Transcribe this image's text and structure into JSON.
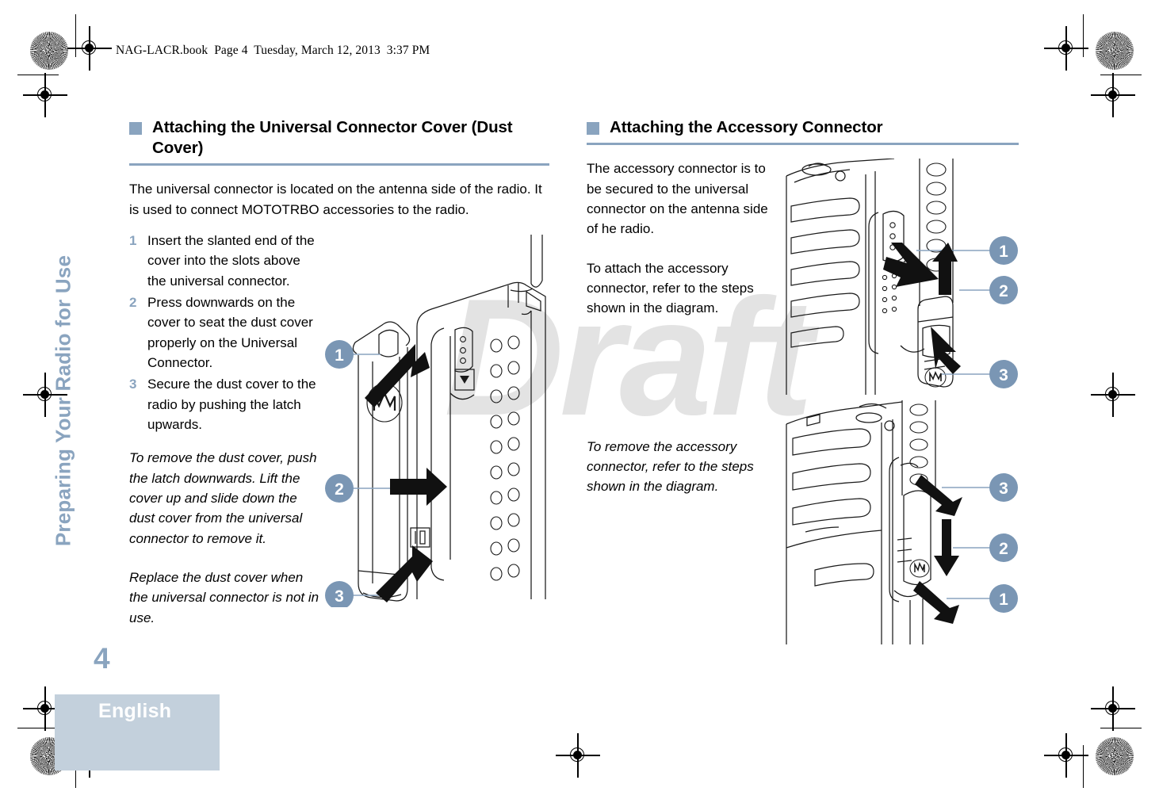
{
  "header": {
    "book_line": "NAG-LACR.book  Page 4  Tuesday, March 12, 2013  3:37 PM"
  },
  "watermark": {
    "text": "Draft"
  },
  "chapter_tab": {
    "label": "Preparing Your Radio for Use"
  },
  "page": {
    "number": "4"
  },
  "footer": {
    "language": "English"
  },
  "colors": {
    "accent": "#8aa4bf",
    "footer_bar": "#c3d0dc",
    "watermark": "#e3e3e3",
    "callout_badge": "#7a96b4",
    "text": "#000000"
  },
  "left_column": {
    "heading": "Attaching the Universal Connector Cover (Dust Cover)",
    "intro": "The universal connector is located on the antenna side of the radio. It is used to connect MOTOTRBO accessories to the radio.",
    "steps": [
      {
        "number": "1",
        "text": "Insert the slanted end of the cover into the slots above the universal connector."
      },
      {
        "number": "2",
        "text": "Press downwards on the cover to seat the dust cover properly on the Universal Connector."
      },
      {
        "number": "3",
        "text": "Secure the dust cover to the radio by pushing the latch upwards."
      }
    ],
    "notes": [
      "To remove the dust cover, push the latch downwards. Lift the cover up and slide down the dust cover from the universal connector to remove it.",
      "Replace the dust cover when the universal connector is not in use."
    ],
    "figure": {
      "name": "dust-cover-attach-diagram",
      "callouts": [
        "1",
        "2",
        "3"
      ]
    }
  },
  "right_column": {
    "heading": "Attaching the Accessory Connector",
    "paragraphs": [
      "The accessory connector is to be secured to the universal connector on the antenna side of he radio.",
      "To attach the accessory connector, refer to the steps shown in the diagram."
    ],
    "note": "To remove the accessory connector, refer to the steps shown in the diagram.",
    "figure_attach": {
      "name": "accessory-connector-attach-diagram",
      "callouts": [
        "1",
        "2",
        "3"
      ]
    },
    "figure_remove": {
      "name": "accessory-connector-remove-diagram",
      "callouts": [
        "3",
        "2",
        "1"
      ]
    }
  }
}
